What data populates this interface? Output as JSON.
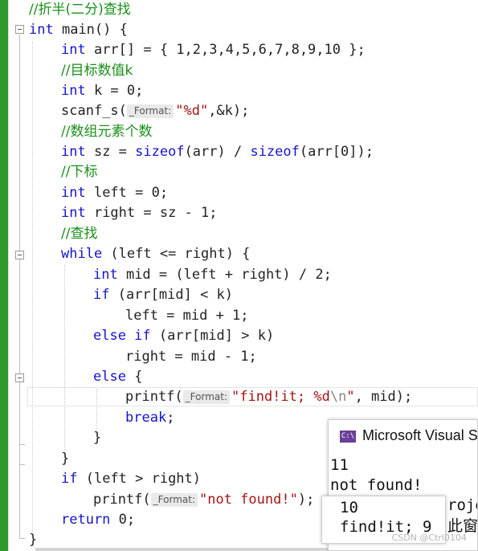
{
  "code": {
    "line_comment_top": "//折半(二分)查找",
    "main_int": "int",
    "main_sig": " main() {",
    "arr_int": "int",
    "arr_rest": " arr[] = { 1,2,3,4,5,6,7,8,9,10 };",
    "cmt_k": "//目标数值k",
    "k_int": "int",
    "k_rest": " k = 0;",
    "scanf_fn": "scanf_s(",
    "scanf_hint": "_Format:",
    "scanf_str": "\"%d\"",
    "scanf_rest": ",&k);",
    "cmt_count": "//数组元素个数",
    "sz_int": "int",
    "sz_a": " sz = ",
    "sz_sizeof1": "sizeof",
    "sz_b": "(arr) / ",
    "sz_sizeof2": "sizeof",
    "sz_c": "(arr[0]);",
    "cmt_index": "//下标",
    "left_int": "int",
    "left_rest": " left = 0;",
    "right_int": "int",
    "right_rest": " right = sz - 1;",
    "cmt_search": "//查找",
    "while_kw": "while",
    "while_rest": " (left <= right) {",
    "mid_int": "int",
    "mid_rest": " mid = (left + right) / 2;",
    "if1_kw": "if",
    "if1_rest": " (arr[mid] < k)",
    "left_assign": "left = mid + 1;",
    "elseif_kw": "else if",
    "elseif_rest": " (arr[mid] > k)",
    "right_assign": "right = mid - 1;",
    "else_kw": "else",
    "else_rest": " {",
    "printf1_fn": "printf(",
    "printf1_hint": "_Format:",
    "printf1_str_a": "\"find!it; %d",
    "printf1_esc": "\\n",
    "printf1_str_b": "\"",
    "printf1_rest": ", mid);",
    "break_kw": "break",
    "break_rest": ";",
    "close_brace_inner": "}",
    "close_brace_while": "}",
    "if2_kw": "if",
    "if2_rest": " (left > right)",
    "printf2_fn": "printf(",
    "printf2_hint": "_Format:",
    "printf2_str": "\"not found!\"",
    "printf2_rest": ");",
    "return_kw": "return",
    "return_rest": " 0;",
    "close_brace_main": "}"
  },
  "console_window_1": {
    "title": "Microsoft Visual S",
    "icon_name": "console-app-icon",
    "lines": [
      "11",
      "not found!",
      "roje",
      "此窗"
    ]
  },
  "console_window_2": {
    "lines": [
      "10",
      "find!it; 9"
    ]
  },
  "watermark": "CSDN @Ctrl0104",
  "colors": {
    "keyword": "#1515c9",
    "comment": "#1a8f1a",
    "string": "#a31515",
    "change_bar": "#2e9a2e"
  }
}
